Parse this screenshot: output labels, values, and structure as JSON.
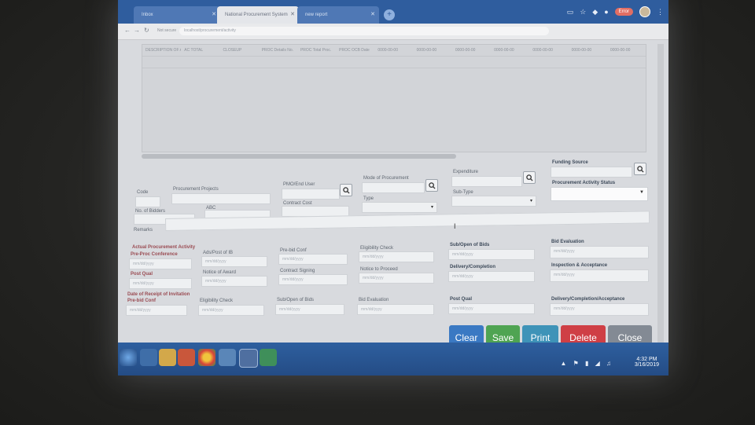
{
  "browser": {
    "tabs": [
      {
        "label": "Inbox"
      },
      {
        "label": "National Procurement System"
      },
      {
        "label": "new report"
      }
    ],
    "url": "localhost/procurement/activity",
    "secure_label": "Not secure",
    "user_label": "Error"
  },
  "grid": {
    "columns": [
      "DESCRIPTION OF ABOVE PROCESS",
      "AC TOTAL",
      "CLOSEUP",
      "PROC Details No.",
      "PROC Total Proc.",
      "PROC OCB Date",
      "0000-00-00",
      "0000-00-00",
      "0000-00-00",
      "0000-00-00",
      "0000-00-00",
      "0000-00-00",
      "0000-00-00"
    ]
  },
  "form": {
    "code_label": "Code",
    "projects_label": "Procurement Projects",
    "pmo_label": "PMO/End User",
    "mode_label": "Mode of Procurement",
    "expenditure_label": "Expenditure",
    "funding_label": "Funding Source",
    "activity_status_label": "Procurement Activity Status",
    "type_label": "Type",
    "subtype_label": "Sub-Type",
    "contract_cost_label": "Contract Cost",
    "abc_label": "ABC",
    "bidders_label": "No. of Bidders",
    "remarks_label": "Remarks",
    "actual_activity_label": "Actual Procurement Activity",
    "pre_proc_label": "Pre-Proc Conference",
    "ads_label": "Ads/Post of IB",
    "prebid_label": "Pre-bid Conf",
    "eligibility_label": "Eligibility Check",
    "subopen_label": "Sub/Open of Bids",
    "bid_eval_label": "Bid Evaluation",
    "post_qual_label": "Post Qual",
    "noa_label": "Notice of Award",
    "contract_signing_label": "Contract Signing",
    "ntp_label": "Notice to Proceed",
    "delivery_label": "Delivery/Completion",
    "inspection_label": "Inspection & Acceptance",
    "receipt_label": "Date of Receipt of Invitation",
    "prebid2_label": "Pre-bid Conf",
    "eligibility2_label": "Eligibility Check",
    "subopen2_label": "Sub/Open of Bids",
    "bid_eval2_label": "Bid Evaluation",
    "post_qual2_label": "Post Qual",
    "delivery_accept_label": "Delivery/Completion/Acceptance",
    "date_placeholder": "mm/dd/yyyy"
  },
  "buttons": {
    "clear": "Clear",
    "save": "Save",
    "print": "Print",
    "delete": "Delete",
    "close": "Close"
  },
  "taskbar": {
    "time": "4:32 PM",
    "date": "3/16/2019"
  },
  "colors": {
    "clear": "#3a79c3",
    "save": "#4fa452",
    "print": "#3e93b8",
    "delete": "#cf3f45",
    "close": "#838a94"
  }
}
